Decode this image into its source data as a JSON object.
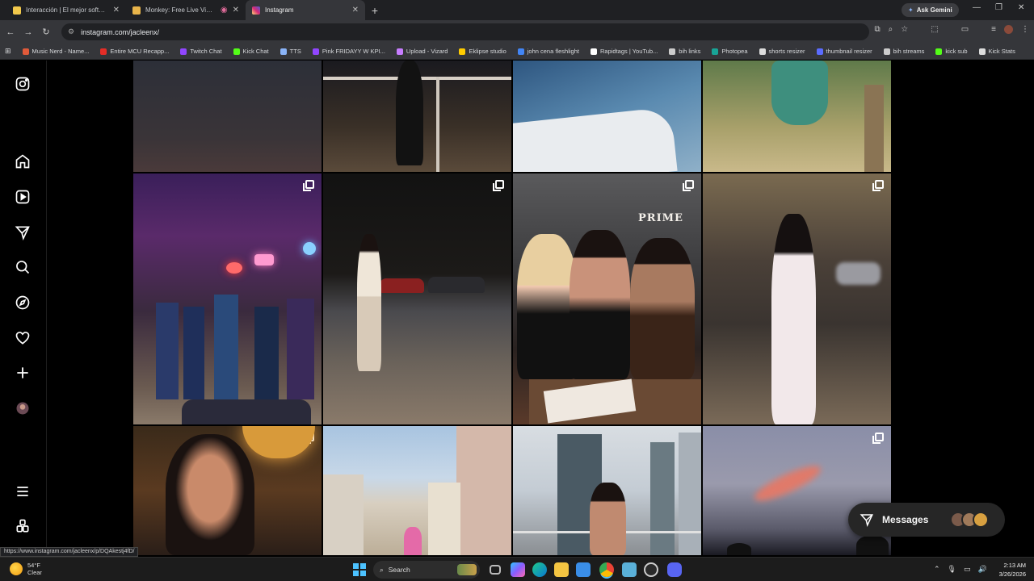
{
  "browser": {
    "tabs": [
      {
        "title": "Interacción | El mejor software",
        "color": "#f2c94c",
        "active": false
      },
      {
        "title": "Monkey: Free Live Video Ch",
        "color": "#e8b44a",
        "active": false
      },
      {
        "title": "Instagram",
        "color": "#d6249f",
        "active": true
      }
    ],
    "new_tab": "+",
    "ask_gemini": "Ask Gemini",
    "url": "instagram.com/jacleenx/",
    "bookmarks": [
      {
        "label": "Music Nerd - Name...",
        "color": "#e05a3a"
      },
      {
        "label": "Entire MCU Recapp...",
        "color": "#e52d27"
      },
      {
        "label": "Twitch Chat",
        "color": "#9146ff"
      },
      {
        "label": "Kick Chat",
        "color": "#53fc18"
      },
      {
        "label": "TTS",
        "color": "#8ab4f8"
      },
      {
        "label": "Pink FRIDAYY W KPI...",
        "color": "#9146ff"
      },
      {
        "label": "Upload - Vizard",
        "color": "#c77dff"
      },
      {
        "label": "Eklipse studio",
        "color": "#ffcc00"
      },
      {
        "label": "john cena fleshlight",
        "color": "#4285f4"
      },
      {
        "label": "Rapidtags | YouTub...",
        "color": "#ffffff"
      },
      {
        "label": "bih links",
        "color": "#cccccc"
      },
      {
        "label": "Photopea",
        "color": "#18a497"
      },
      {
        "label": "shorts resizer",
        "color": "#dddddd"
      },
      {
        "label": "thumbnail resizer",
        "color": "#5b6cff"
      },
      {
        "label": "bih streams",
        "color": "#cccccc"
      },
      {
        "label": "kick sub",
        "color": "#53fc18"
      },
      {
        "label": "Kick Stats",
        "color": "#dddddd"
      }
    ]
  },
  "instagram": {
    "sidebar_icons": [
      "instagram-logo-icon",
      "home-icon",
      "reels-icon",
      "messages-icon",
      "search-icon",
      "explore-icon",
      "notifications-icon",
      "create-icon",
      "profile-avatar-icon",
      "more-menu-icon",
      "also-from-meta-icon"
    ],
    "messages": {
      "label": "Messages"
    }
  },
  "status_link": "https://www.instagram.com/jacleenx/p/DQAkestj4fD/",
  "taskbar": {
    "weather_temp": "54°F",
    "weather_desc": "Clear",
    "search_label": "Search",
    "time": "2:13 AM",
    "date": "3/26/2026"
  },
  "colors": {
    "accent": "#4cc2ff",
    "instagram_bg": "#000000"
  }
}
